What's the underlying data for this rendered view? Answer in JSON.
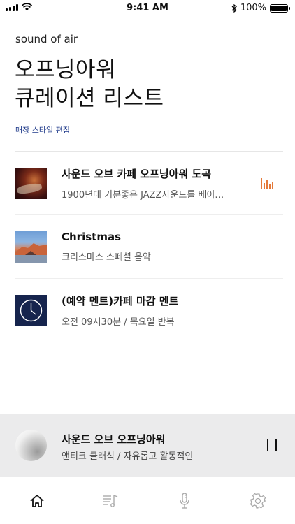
{
  "status_bar": {
    "time": "9:41 AM",
    "battery": "100%"
  },
  "header": {
    "brand": "sound of air",
    "title_line1": "오프닝아워",
    "title_line2": "큐레이션 리스트",
    "edit_link": "매장 스타일 편집"
  },
  "playlist": [
    {
      "title": "사운드 오브 카페 오프닝아워 도곡",
      "subtitle": "1900년대 기분좋은 JAZZ사운드를 베이…",
      "thumb_icon": "cafe-photo",
      "playing": true
    },
    {
      "title": "Christmas",
      "subtitle": "크리스마스 스페셜 음악",
      "thumb_icon": "mountain-photo",
      "playing": false
    },
    {
      "title": "(예약 멘트)카페 마감 멘트",
      "subtitle": "오전 09시30분 / 목요일 반복",
      "thumb_icon": "clock-icon",
      "playing": false
    }
  ],
  "now_playing": {
    "title": "사운드 오브 오프닝아워",
    "subtitle": "앤티크 클래식 / 자유롭고 활동적인",
    "state": "playing"
  },
  "tab_bar": {
    "tabs": [
      "home-icon",
      "music-list-icon",
      "microphone-icon",
      "settings-icon"
    ],
    "active": "home-icon"
  },
  "colors": {
    "accent": "#e4793a",
    "link": "#1f3a8a",
    "clock_bg": "#16244d",
    "player_bg": "#ebebec"
  }
}
